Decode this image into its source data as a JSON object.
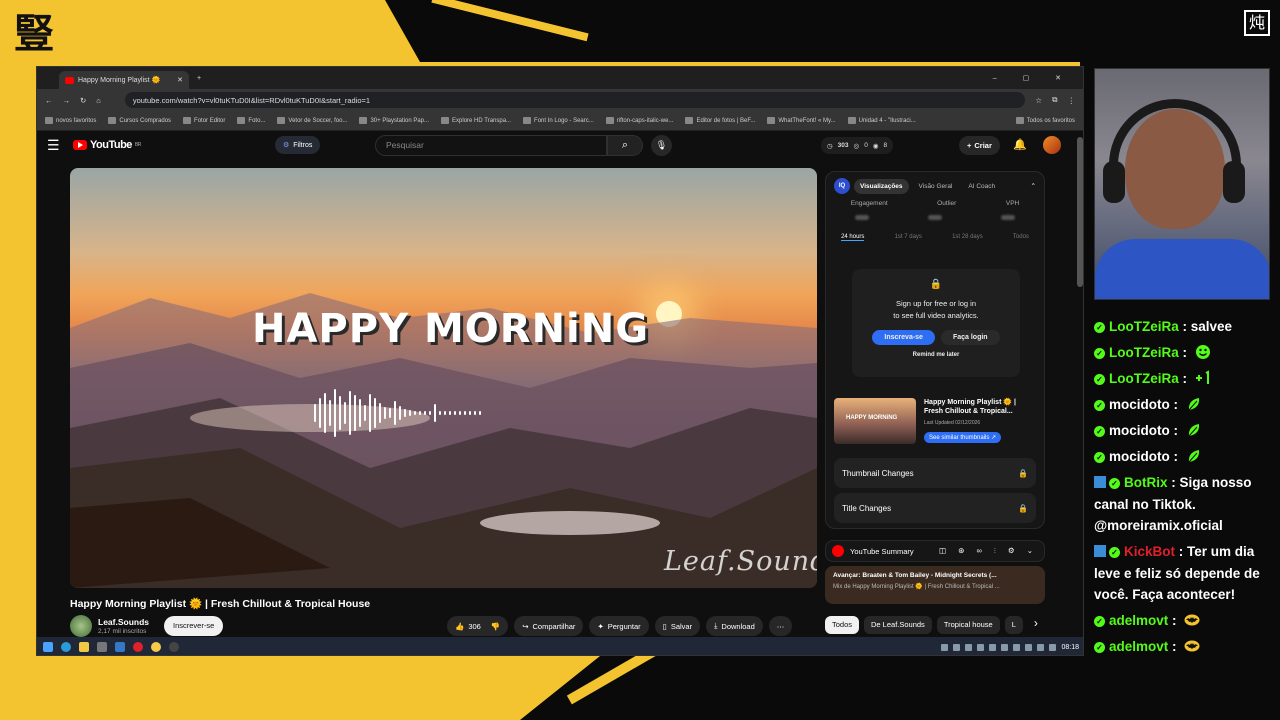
{
  "overlay": {
    "logo_left": "豎",
    "logo_right": "炖"
  },
  "browser": {
    "tab_title": "Happy Morning Playlist 🌞",
    "url": "youtube.com/watch?v=vl0tuKTuD0I&list=RDvl0tuKTuD0I&start_radio=1",
    "bookmarks": [
      "novos favoritos",
      "Cursos Comprados",
      "Fotor Editor",
      "Foto...",
      "Vetor de Soccer, foo...",
      "30+ Playstation Pap...",
      "Explore HD Transpa...",
      "Font In Logo - Searc...",
      "rifton-caps-italic-we...",
      "Editor de fotos | BeF...",
      "WhatTheFont! « My...",
      "Unidad 4 - \"Ilustraci...",
      "Todos os favoritos"
    ]
  },
  "youtube": {
    "logo": "YouTube",
    "logo_badge": "BR",
    "filter_label": "Filtros",
    "search_placeholder": "Pesquisar",
    "stats": {
      "views": "303",
      "a": "0",
      "b": "8"
    },
    "create_label": "Criar"
  },
  "video": {
    "overlay_title": "HAPPY MORNiNG",
    "watermark": "Leaf.Sounds",
    "title": "Happy Morning Playlist 🌞 | Fresh Chillout & Tropical House",
    "channel": "Leaf.Sounds",
    "subscribers": "2,17 mil inscritos",
    "subscribe_label": "Inscrever-se",
    "likes": "306",
    "share_label": "Compartilhar",
    "ask_label": "Perguntar",
    "save_label": "Salvar",
    "download_label": "Download"
  },
  "chips": [
    "Todos",
    "De Leaf.Sounds",
    "Tropical house",
    "L"
  ],
  "analytics": {
    "tabs": [
      "Visualizações",
      "Visão Geral",
      "AI Coach"
    ],
    "iq": "IQ",
    "metrics": [
      "Engagement",
      "Outlier",
      "VPH"
    ],
    "ranges": [
      "24 hours",
      "1st 7 days",
      "1st 28 days",
      "Todos"
    ],
    "gate_line1": "Sign up for free or log in",
    "gate_line2": "to see full video analytics.",
    "signup_label": "Inscreva-se",
    "login_label": "Faça login",
    "remind_label": "Remind me later",
    "thumb_text": "HAPPY MORNiNG",
    "thumb_title": "Happy Morning Playlist 🌞 | Fresh Chillout & Tropical...",
    "last_updated": "Last Updated 02/12/2026",
    "similar_label": "See similar thumbnails ↗",
    "thumbnail_changes": "Thumbnail Changes",
    "title_changes": "Title Changes",
    "summary_label": "YouTube Summary",
    "next_label": "Avançar: Braaten & Tom Bailey - Midnight Secrets (...",
    "next_sub": "Mix de Happy Morning Playlist 🌞 | Fresh Chillout & Tropical ..."
  },
  "taskbar": {
    "time": "08:18"
  },
  "chat": [
    {
      "user": "LooTZeiRa",
      "text": "salvee",
      "color": "green",
      "bot": false,
      "emote": ""
    },
    {
      "user": "LooTZeiRa",
      "text": "",
      "color": "green",
      "bot": false,
      "emote": "smile"
    },
    {
      "user": "LooTZeiRa",
      "text": "",
      "color": "green",
      "bot": false,
      "emote": "plus1"
    },
    {
      "user": "mocidoto",
      "text": "",
      "color": "white",
      "bot": false,
      "emote": "leaf"
    },
    {
      "user": "mocidoto",
      "text": "",
      "color": "white",
      "bot": false,
      "emote": "leaf"
    },
    {
      "user": "mocidoto",
      "text": "",
      "color": "white",
      "bot": false,
      "emote": "leaf"
    },
    {
      "user": "BotRix",
      "text": "Siga nosso canal no Tiktok. @moreiramix.oficial",
      "color": "green",
      "bot": true,
      "emote": ""
    },
    {
      "user": "KickBot",
      "text": "Ter um dia leve e feliz só depende de você. Faça acontecer!",
      "color": "red",
      "bot": true,
      "emote": ""
    },
    {
      "user": "adelmovt",
      "text": "",
      "color": "green",
      "bot": false,
      "emote": "batman"
    },
    {
      "user": "adelmovt",
      "text": "",
      "color": "green",
      "bot": false,
      "emote": "batman"
    }
  ]
}
